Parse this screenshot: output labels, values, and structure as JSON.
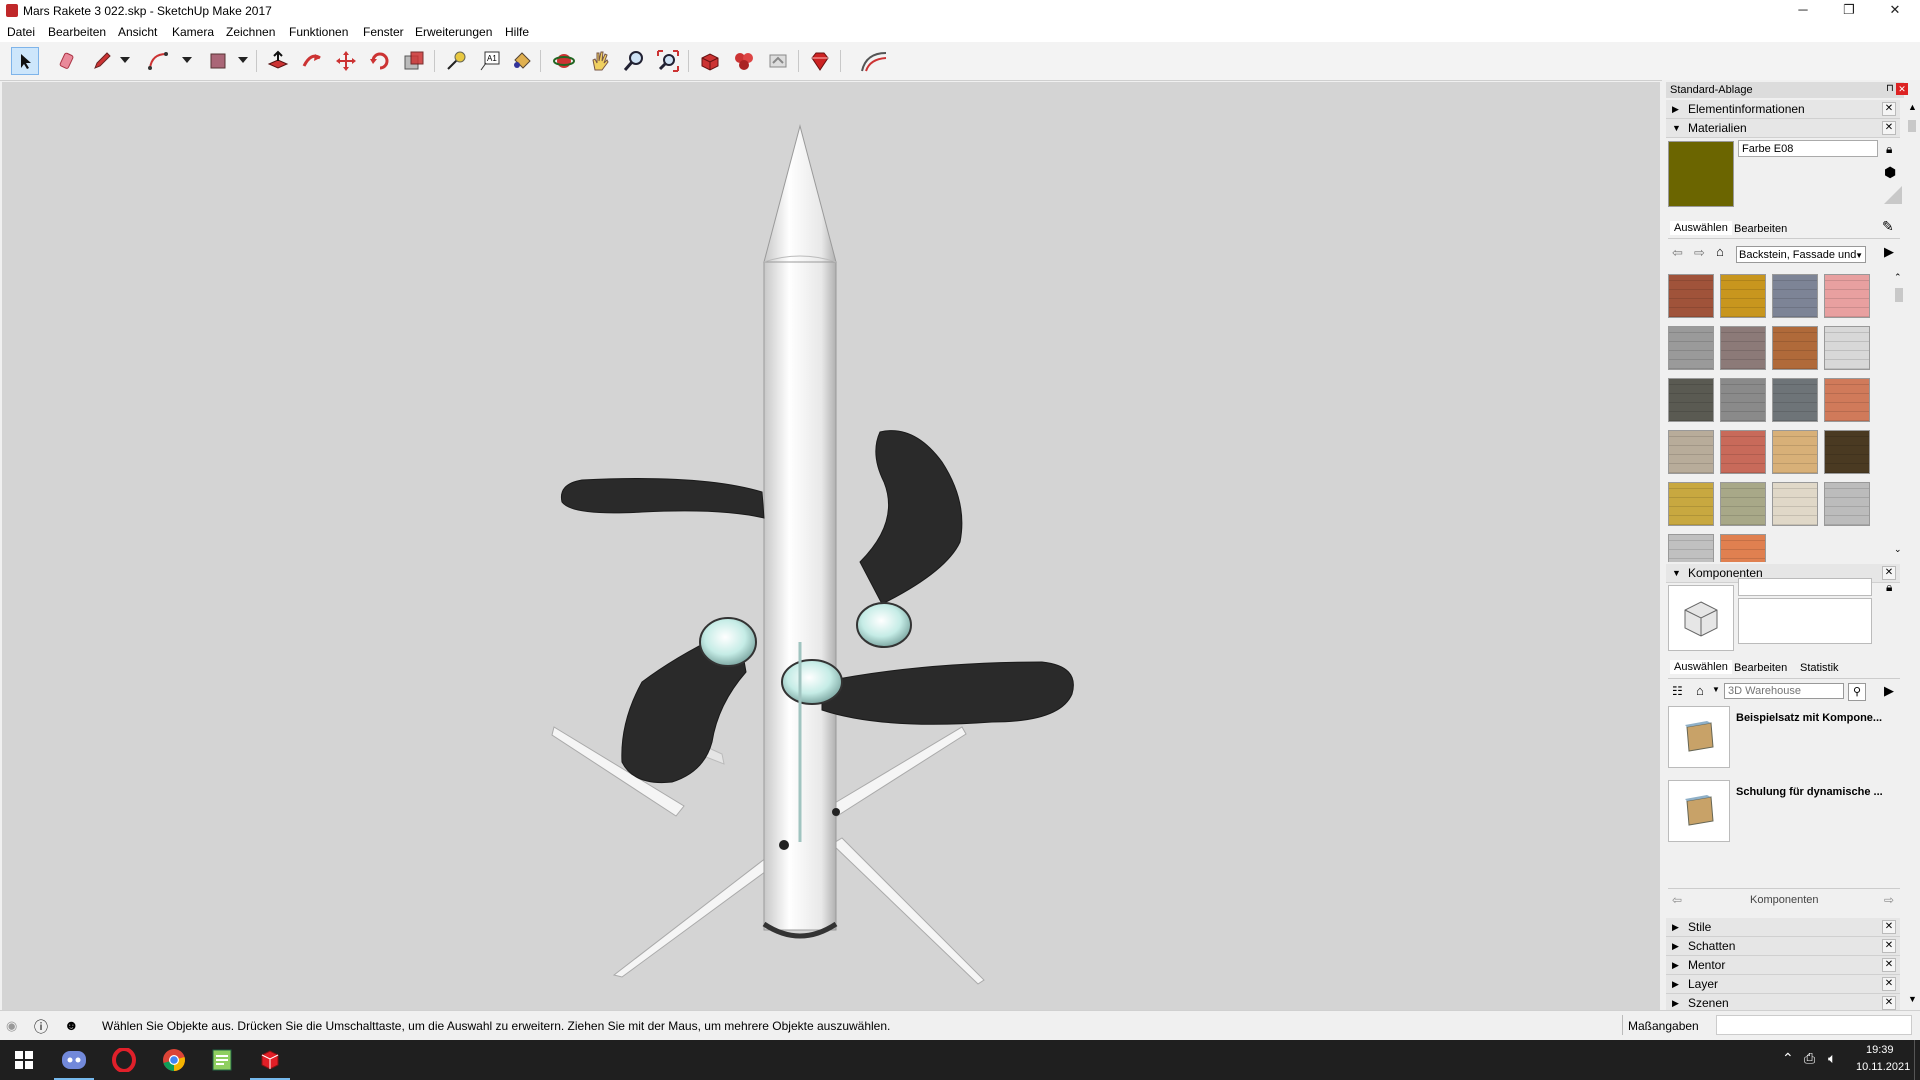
{
  "window": {
    "title": "Mars Rakete 3 022.skp - SketchUp Make 2017",
    "minimize": "─",
    "restore": "❐",
    "close": "✕"
  },
  "menu": [
    "Datei",
    "Bearbeiten",
    "Ansicht",
    "Kamera",
    "Zeichnen",
    "Funktionen",
    "Fenster",
    "Erweiterungen",
    "Hilfe"
  ],
  "toolbar": {
    "tools": [
      "select-icon",
      "eraser-icon",
      "pencil-icon",
      "arc-icon",
      "rectangle-icon",
      "pushpull-icon",
      "followme-icon",
      "move-icon",
      "rotate-icon",
      "scale-icon",
      "tape-measure-icon",
      "text-icon",
      "paint-bucket-icon",
      "orbit-icon",
      "pan-icon",
      "zoom-icon",
      "zoom-extents-icon",
      "3d-warehouse-icon",
      "extension-warehouse-icon",
      "share-model-icon",
      "ruby-icon",
      "sandbox-icon"
    ]
  },
  "tray": {
    "title": "Standard-Ablage",
    "element_info": "Elementinformationen",
    "materials": {
      "header": "Materialien",
      "current_name": "Farbe E08",
      "current_color": "#6b6500",
      "tab_select": "Auswählen",
      "tab_edit": "Bearbeiten",
      "library": "Backstein, Fassade und",
      "swatch_colors": [
        "#a0533a",
        "#c8961e",
        "#7d8496",
        "#e8a0a0",
        "#9a9a9a",
        "#8c7a78",
        "#b06a3a",
        "#d8d8d8",
        "#5a5a52",
        "#8a8a8a",
        "#6e7478",
        "#d07a5a",
        "#b8ac9a",
        "#c86a5a",
        "#d8b078",
        "#4a3a22",
        "#c8a840",
        "#a8a888",
        "#e0d8c8",
        "#bcbcbc",
        "#c0c0c0",
        "#e08050"
      ]
    },
    "components": {
      "header": "Komponenten",
      "tab_select": "Auswählen",
      "tab_edit": "Bearbeiten",
      "tab_stats": "Statistik",
      "search_placeholder": "3D Warehouse",
      "items": [
        "Beispielsatz mit Kompone...",
        "Schulung für dynamische ..."
      ],
      "footer": "Komponenten"
    },
    "collapsed_panels": [
      "Stile",
      "Schatten",
      "Mentor",
      "Layer",
      "Szenen"
    ]
  },
  "statusbar": {
    "message": "Wählen Sie Objekte aus. Drücken Sie die Umschalttaste, um die Auswahl zu erweitern. Ziehen Sie mit der Maus, um mehrere Objekte auszuwählen.",
    "measurements_label": "Maßangaben",
    "measurements_value": ""
  },
  "taskbar": {
    "time": "19:39",
    "date": "10.11.2021",
    "apps": [
      "windows-start-icon",
      "discord-icon",
      "opera-icon",
      "chrome-icon",
      "notepad-icon",
      "sketchup-icon"
    ]
  }
}
